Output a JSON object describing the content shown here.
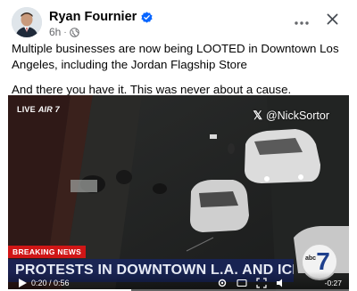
{
  "post": {
    "author": "Ryan Fournier",
    "timestamp": "6h",
    "meta_separator": "·",
    "verified": true,
    "paragraphs": [
      "Multiple businesses are now being LOOTED in Downtown Los Angeles, including the Jordan Flagship Store",
      "And there you have it. This was never about a cause."
    ]
  },
  "video": {
    "live_label": "LIVE",
    "channel_label": "AIR 7",
    "watermark_handle": "@NickSortor",
    "breaking_label": "BREAKING NEWS",
    "headline": "PROTESTS IN DOWNTOWN L.A. AND ICE RAIDS",
    "station_small": "abc",
    "station_number": "7",
    "elapsed_time": "0:20 / 0:56",
    "remaining_time": "-0:27",
    "progress_fraction": 0.36
  },
  "icons": {
    "verified": "verified-badge-icon",
    "audience": "globe-icon",
    "more": "more-options-icon",
    "close": "close-icon",
    "play": "play-icon",
    "settings": "settings-icon",
    "captions": "captions-icon",
    "fullscreen": "fullscreen-icon",
    "volume": "volume-icon"
  },
  "colors": {
    "verified_blue": "#0866ff",
    "breaking_red": "#d01616",
    "headline_bg": "#18245c",
    "secondary_text": "#65676b"
  }
}
